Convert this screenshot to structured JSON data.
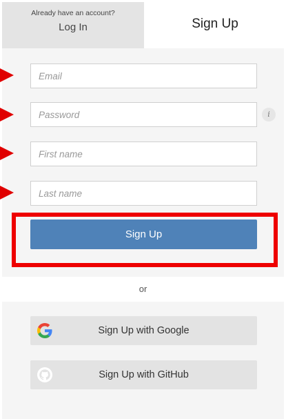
{
  "tabs": {
    "login_hint": "Already have an account?",
    "login_label": "Log In",
    "signup_label": "Sign Up"
  },
  "form": {
    "email_placeholder": "Email",
    "password_placeholder": "Password",
    "first_name_placeholder": "First name",
    "last_name_placeholder": "Last name",
    "info_icon_glyph": "i",
    "submit_label": "Sign Up"
  },
  "separator": "or",
  "social": {
    "google_label": "Sign Up with Google",
    "github_label": "Sign Up with GitHub"
  },
  "colors": {
    "primary_button": "#4f82b8",
    "annotation_red": "#ee0000",
    "panel_bg": "#f5f5f5",
    "social_button_bg": "#e3e3e3"
  },
  "icons": [
    "info-icon",
    "google-icon",
    "github-icon"
  ]
}
